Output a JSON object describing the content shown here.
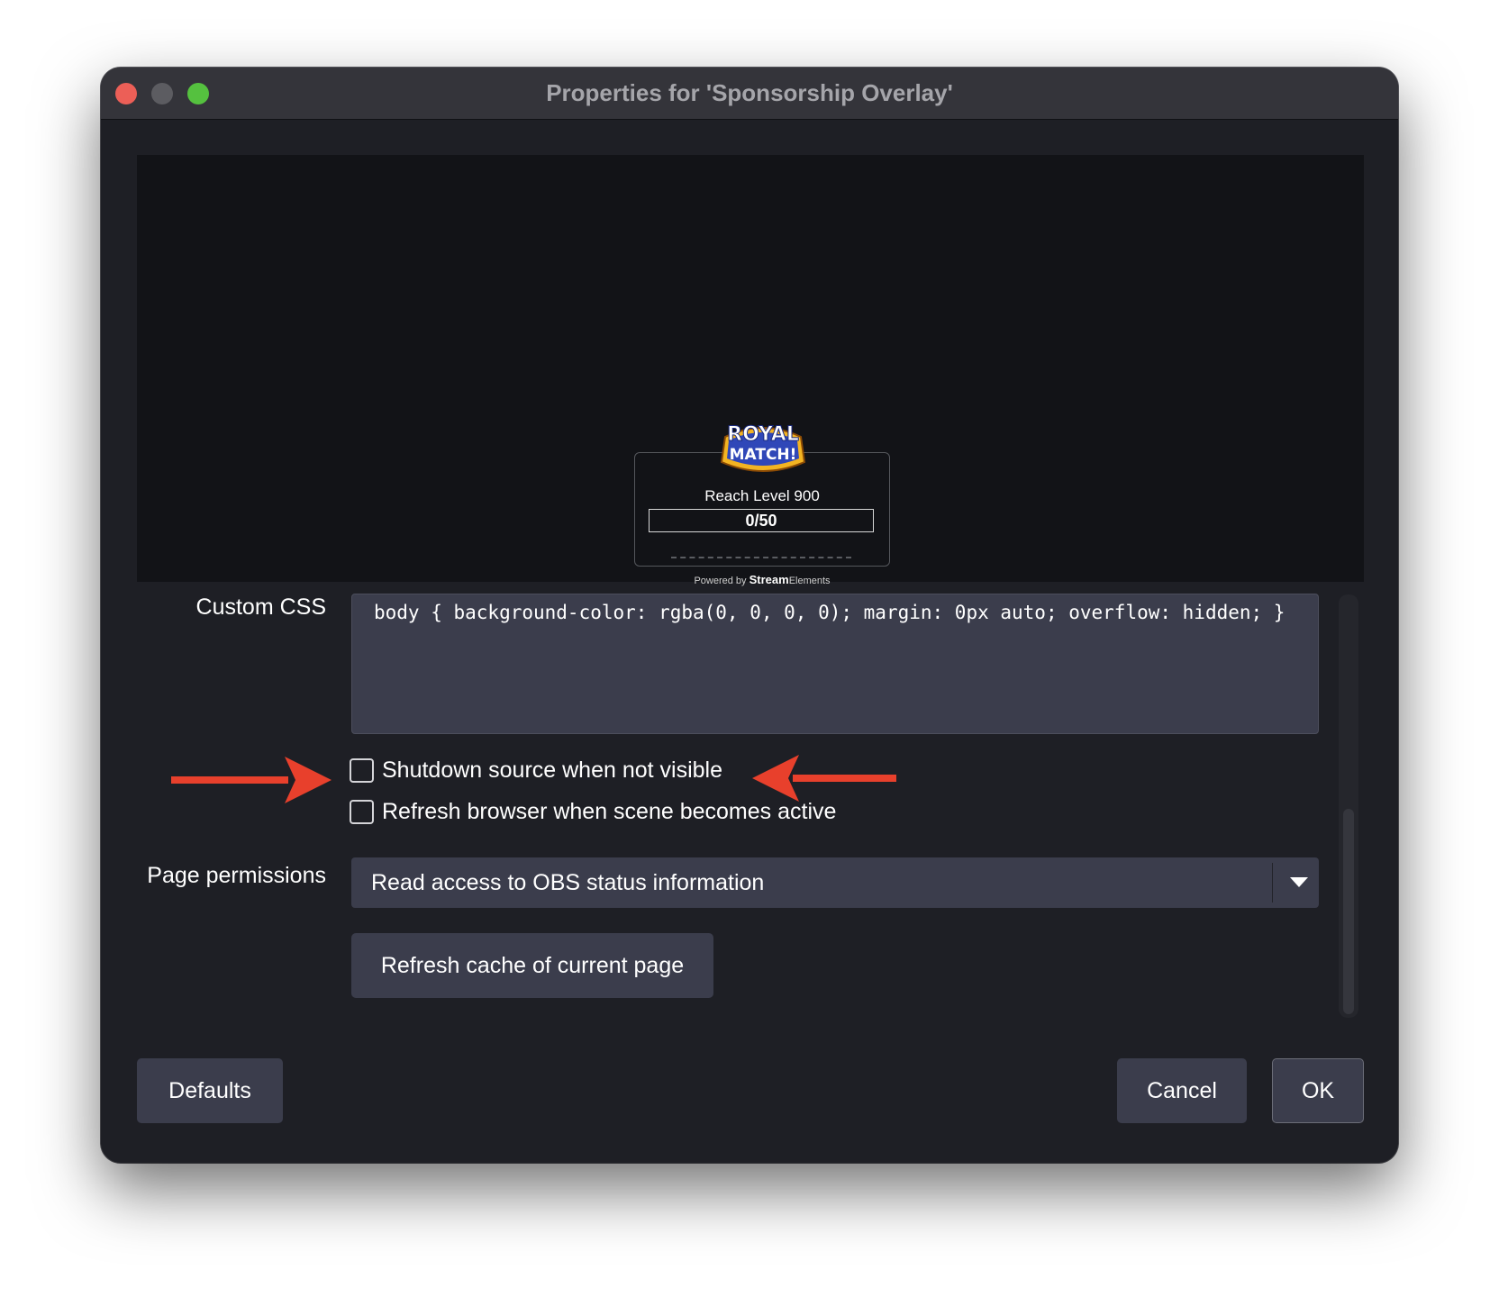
{
  "window": {
    "title": "Properties for 'Sponsorship Overlay'"
  },
  "preview": {
    "logo_line1": "ROYAL",
    "logo_line2": "MATCH!",
    "widget_title": "Reach Level 900",
    "progress_text": "0/50",
    "powered_prefix": "Powered by",
    "powered_brand_bold": "Stream",
    "powered_brand_rest": "Elements"
  },
  "form": {
    "custom_css_label": "Custom CSS",
    "custom_css_value": "body { background-color: rgba(0, 0, 0, 0); margin: 0px auto; overflow: hidden; }",
    "shutdown_label": "Shutdown source when not visible",
    "shutdown_checked": false,
    "refresh_label": "Refresh browser when scene becomes active",
    "refresh_checked": false,
    "page_permissions_label": "Page permissions",
    "page_permissions_value": "Read access to OBS status information",
    "refresh_cache_button": "Refresh cache of current page"
  },
  "footer": {
    "defaults_button": "Defaults",
    "cancel_button": "Cancel",
    "ok_button": "OK"
  },
  "colors": {
    "annotation_arrow": "#e8402c",
    "window_bg": "#1e1f25",
    "field_bg": "#3b3d4c"
  },
  "icons": [
    "close-icon",
    "minimize-icon",
    "zoom-icon",
    "chevron-down-icon",
    "arrow-right-icon",
    "arrow-left-icon"
  ]
}
